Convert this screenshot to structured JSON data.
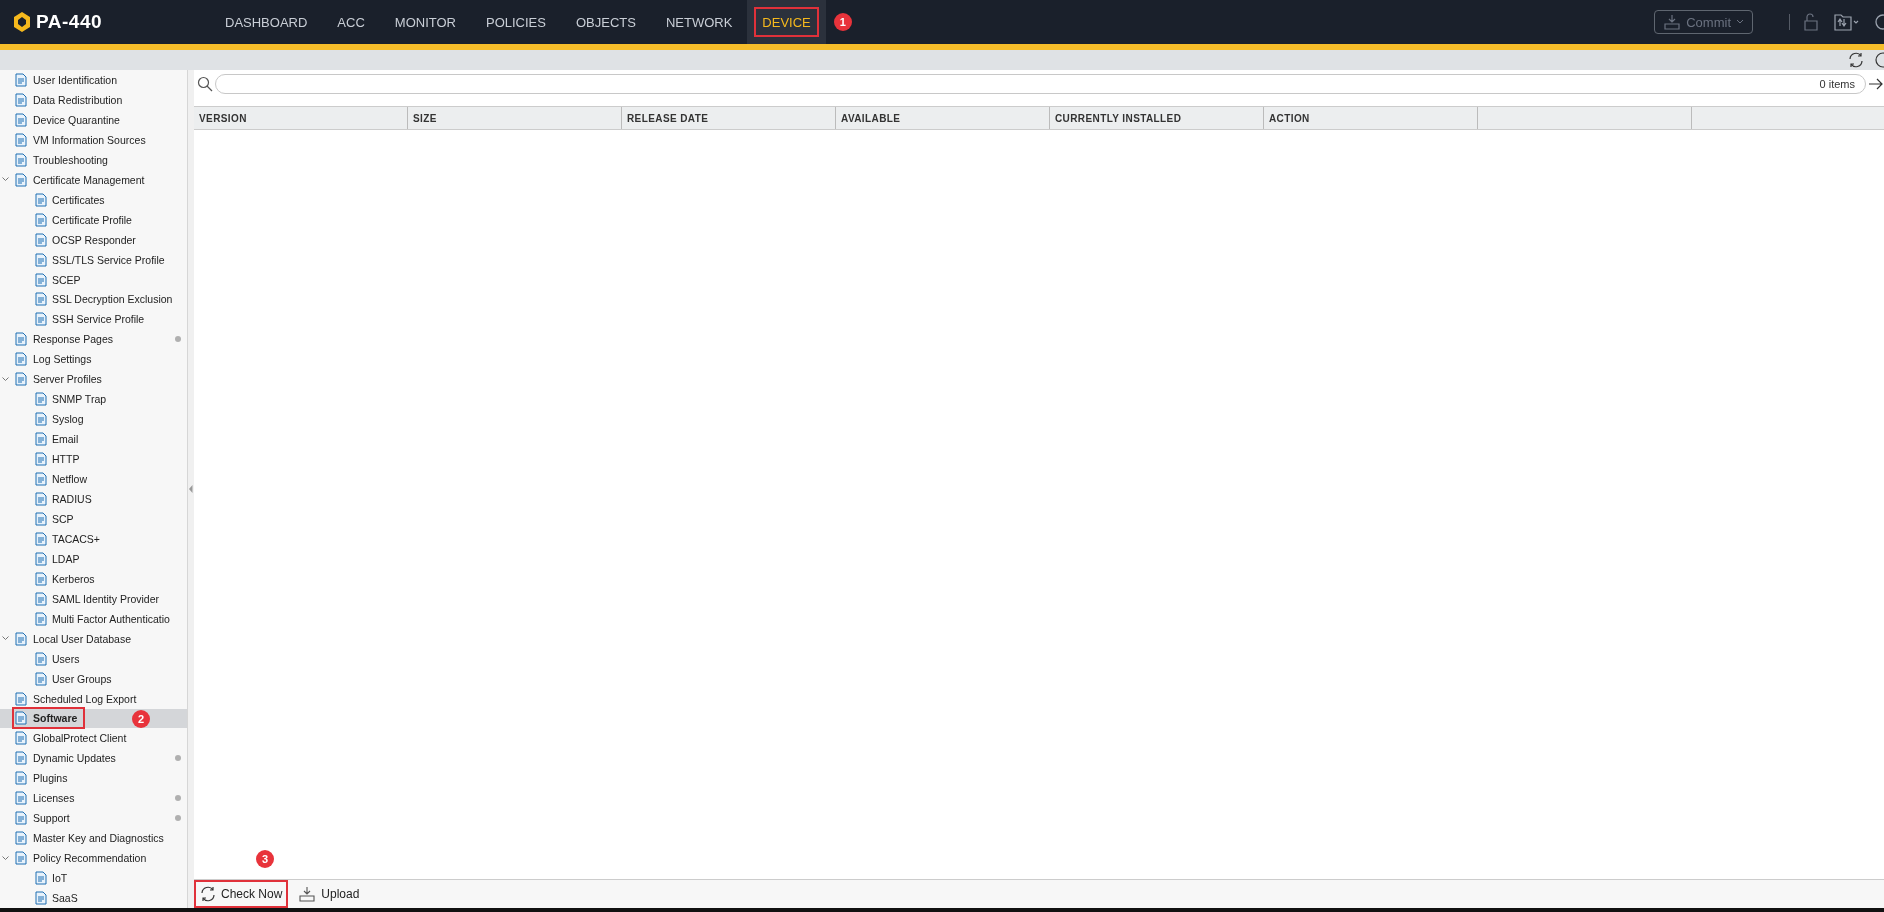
{
  "app": {
    "title": "PA-440"
  },
  "nav": [
    {
      "label": "DASHBOARD",
      "selected": false
    },
    {
      "label": "ACC",
      "selected": false
    },
    {
      "label": "MONITOR",
      "selected": false
    },
    {
      "label": "POLICIES",
      "selected": false
    },
    {
      "label": "OBJECTS",
      "selected": false
    },
    {
      "label": "NETWORK",
      "selected": false
    },
    {
      "label": "DEVICE",
      "selected": true,
      "callout": "1"
    }
  ],
  "commit": {
    "label": "Commit"
  },
  "sidebar": {
    "items": [
      {
        "label": "User Identification",
        "selected": false,
        "dot": false
      },
      {
        "label": "Data Redistribution",
        "selected": false,
        "dot": false
      },
      {
        "label": "Device Quarantine",
        "selected": false,
        "dot": false
      },
      {
        "label": "VM Information Sources",
        "selected": false,
        "dot": false
      },
      {
        "label": "Troubleshooting",
        "selected": false,
        "dot": false
      },
      {
        "label": "Certificate Management",
        "selected": false,
        "dot": false,
        "expanded": true,
        "children": [
          {
            "label": "Certificates",
            "selected": false
          },
          {
            "label": "Certificate Profile",
            "selected": false
          },
          {
            "label": "OCSP Responder",
            "selected": false
          },
          {
            "label": "SSL/TLS Service Profile",
            "selected": false
          },
          {
            "label": "SCEP",
            "selected": false
          },
          {
            "label": "SSL Decryption Exclusion",
            "selected": false
          },
          {
            "label": "SSH Service Profile",
            "selected": false
          }
        ]
      },
      {
        "label": "Response Pages",
        "selected": false,
        "dot": true
      },
      {
        "label": "Log Settings",
        "selected": false,
        "dot": false
      },
      {
        "label": "Server Profiles",
        "selected": false,
        "dot": false,
        "expanded": true,
        "children": [
          {
            "label": "SNMP Trap",
            "selected": false
          },
          {
            "label": "Syslog",
            "selected": false
          },
          {
            "label": "Email",
            "selected": false
          },
          {
            "label": "HTTP",
            "selected": false
          },
          {
            "label": "Netflow",
            "selected": false
          },
          {
            "label": "RADIUS",
            "selected": false
          },
          {
            "label": "SCP",
            "selected": false
          },
          {
            "label": "TACACS+",
            "selected": false
          },
          {
            "label": "LDAP",
            "selected": false
          },
          {
            "label": "Kerberos",
            "selected": false
          },
          {
            "label": "SAML Identity Provider",
            "selected": false
          },
          {
            "label": "Multi Factor Authenticatio",
            "selected": false
          }
        ]
      },
      {
        "label": "Local User Database",
        "selected": false,
        "dot": false,
        "expanded": true,
        "children": [
          {
            "label": "Users",
            "selected": false
          },
          {
            "label": "User Groups",
            "selected": false
          }
        ]
      },
      {
        "label": "Scheduled Log Export",
        "selected": false,
        "dot": false
      },
      {
        "label": "Software",
        "selected": true,
        "dot": false,
        "callout": "2"
      },
      {
        "label": "GlobalProtect Client",
        "selected": false,
        "dot": false
      },
      {
        "label": "Dynamic Updates",
        "selected": false,
        "dot": true
      },
      {
        "label": "Plugins",
        "selected": false,
        "dot": false
      },
      {
        "label": "Licenses",
        "selected": false,
        "dot": true
      },
      {
        "label": "Support",
        "selected": false,
        "dot": true
      },
      {
        "label": "Master Key and Diagnostics",
        "selected": false,
        "dot": false
      },
      {
        "label": "Policy Recommendation",
        "selected": false,
        "dot": false,
        "expanded": true,
        "children": [
          {
            "label": "IoT",
            "selected": false
          },
          {
            "label": "SaaS",
            "selected": false
          }
        ]
      }
    ]
  },
  "search": {
    "count": "0 items"
  },
  "table": {
    "columns": [
      "VERSION",
      "SIZE",
      "RELEASE DATE",
      "AVAILABLE",
      "CURRENTLY INSTALLED",
      "ACTION"
    ]
  },
  "toolbar": [
    {
      "label": "Check Now",
      "kind": "refresh",
      "callout": "3"
    },
    {
      "label": "Upload",
      "kind": "upload"
    }
  ]
}
